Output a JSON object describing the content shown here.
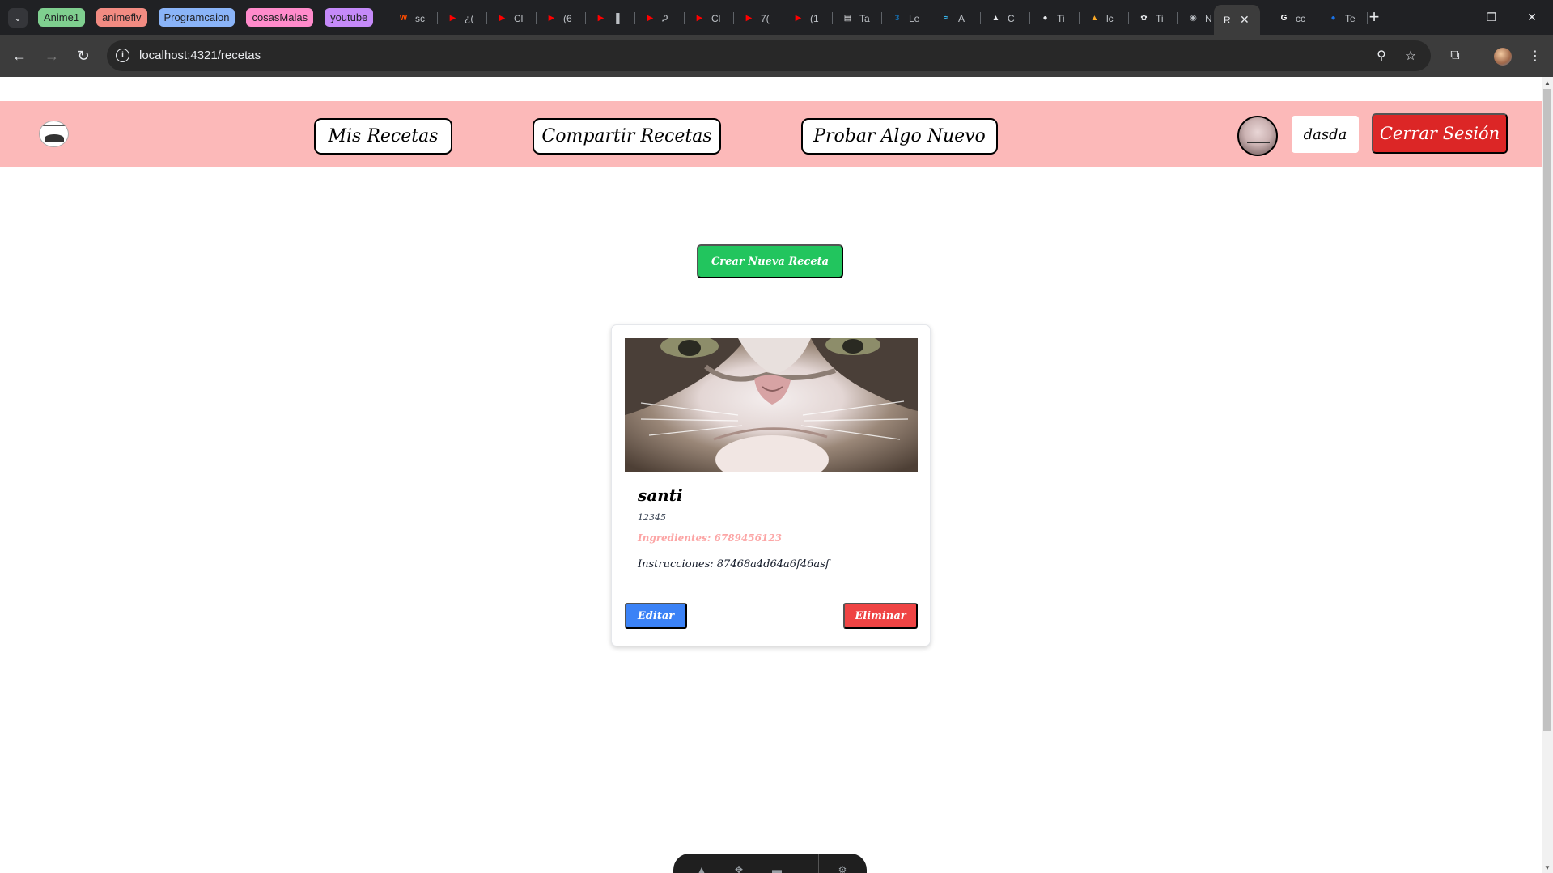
{
  "browser": {
    "tab_groups": [
      {
        "label": "Anime1",
        "color": "#7fcf8f"
      },
      {
        "label": "animeflv",
        "color": "#f28b82"
      },
      {
        "label": "Programcaion",
        "color": "#8ab4f8"
      },
      {
        "label": "cosasMalas",
        "color": "#ff8bcb"
      },
      {
        "label": "youtube",
        "color": "#c58af9"
      }
    ],
    "tabs": [
      {
        "icon": "w-brand-icon",
        "label": "sc",
        "color": "#ff4c00",
        "glyph": "W"
      },
      {
        "icon": "youtube-icon",
        "label": "¿(",
        "color": "#ff0000",
        "glyph": "▶"
      },
      {
        "icon": "youtube-icon",
        "label": "Cl",
        "color": "#ff0000",
        "glyph": "▶"
      },
      {
        "icon": "youtube-icon",
        "label": "(6",
        "color": "#ff0000",
        "glyph": "▶"
      },
      {
        "icon": "youtube-icon",
        "label": "▐",
        "color": "#ff0000",
        "glyph": "▶"
      },
      {
        "icon": "youtube-icon",
        "label": "ጋ",
        "color": "#ff0000",
        "glyph": "▶"
      },
      {
        "icon": "youtube-icon",
        "label": "Cl",
        "color": "#ff0000",
        "glyph": "▶"
      },
      {
        "icon": "youtube-icon",
        "label": "7(",
        "color": "#ff0000",
        "glyph": "▶"
      },
      {
        "icon": "youtube-icon",
        "label": "(1",
        "color": "#ff0000",
        "glyph": "▶"
      },
      {
        "icon": "document-icon",
        "label": "Ta",
        "color": "#e8eaed",
        "glyph": "▤"
      }
    ],
    "tabs_right": [
      {
        "icon": "css3-icon",
        "label": "Le",
        "color": "#1572b6",
        "glyph": "3"
      },
      {
        "icon": "tailwind-icon",
        "label": "A",
        "color": "#38bdf8",
        "glyph": "≈"
      },
      {
        "icon": "astro-icon",
        "label": "C",
        "color": "#e8eaed",
        "glyph": "▲"
      },
      {
        "icon": "github-icon",
        "label": "Ti",
        "color": "#e8eaed",
        "glyph": "●"
      },
      {
        "icon": "mountain-icon",
        "label": "lc",
        "color": "#f9a825",
        "glyph": "▲"
      },
      {
        "icon": "openai-icon",
        "label": "Ti",
        "color": "#e8eaed",
        "glyph": "✿"
      },
      {
        "icon": "chrome-icon",
        "label": "N",
        "color": "#bdc1c6",
        "glyph": "◉"
      }
    ],
    "active_tab": {
      "label": "R",
      "close": "✕"
    },
    "tabs_after": [
      {
        "icon": "google-icon",
        "label": "cc",
        "color": "#ffffff",
        "glyph": "G"
      },
      {
        "icon": "globe-icon",
        "label": "Te",
        "color": "#1a73e8",
        "glyph": "●"
      }
    ],
    "url": "localhost:4321/recetas"
  },
  "navbar": {
    "links": [
      "Mis Recetas",
      "Compartir Recetas",
      "Probar Algo Nuevo"
    ],
    "username": "dasda",
    "logout_label": "Cerrar Sesión"
  },
  "main": {
    "create_label": "Crear Nueva Receta",
    "recipe": {
      "title": "santi",
      "subtitle": "12345",
      "ingredients": "Ingredientes: 6789456123",
      "instructions": "Instrucciones: 87468a4d64a6f46asf",
      "edit_label": "Editar",
      "delete_label": "Eliminar"
    }
  }
}
